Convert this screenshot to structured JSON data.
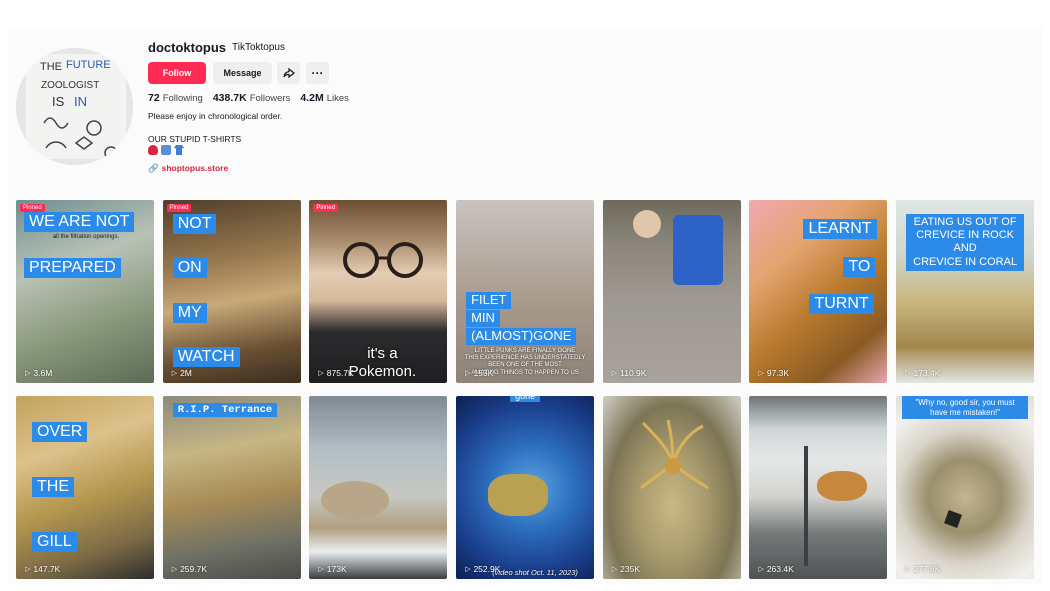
{
  "profile": {
    "username": "doctoktopus",
    "nickname": "TikToktopus",
    "follow_label": "Follow",
    "message_label": "Message",
    "share_icon": "share-icon",
    "more_icon": "more-icon",
    "more_glyph": "···",
    "stats": {
      "following_count": "72",
      "following_label": "Following",
      "followers_count": "438.7K",
      "followers_label": "Followers",
      "likes_count": "4.2M",
      "likes_label": "Likes"
    },
    "bio_line": "Please enjoy in chronological order.",
    "bio_shirts": "OUR STUPID T-SHIRTS",
    "bio_emojis": [
      "octopus",
      "down-arrow",
      "t-shirt"
    ],
    "link_text": "shoptopus.store",
    "avatar_text": [
      "THE FUTURE",
      "ZOOLOGIST",
      "IS IN"
    ]
  },
  "colors": {
    "brand": "#fe2c55",
    "caption_blue": "#2c8ae8",
    "link": "#d7263d"
  },
  "videos": [
    {
      "views": "3.6M",
      "pinned": "Pinned",
      "captions": [
        "WE ARE NOT",
        "PREPARED"
      ],
      "small": "all the filtration openings."
    },
    {
      "views": "2M",
      "pinned": "Pinned",
      "captions": [
        "NOT",
        "ON",
        "MY",
        "WATCH"
      ]
    },
    {
      "views": "875.7K",
      "pinned": "Pinned",
      "overlay": "it's a\nPokemon."
    },
    {
      "views": "153K",
      "captions": [
        "FILET",
        "MIN",
        "(ALMOST)GONE"
      ],
      "small": "LITTLE PUNKS ARE FINALLY GONE\nTHIS EXPERIENCE HAS UNDERSTATEDLY\nBEEN ONE OF THE MOST\nAMAZING THINGS TO HAPPEN TO US"
    },
    {
      "views": "110.9K"
    },
    {
      "views": "97.3K",
      "captions": [
        "LEARNT",
        "TO",
        "TURNT"
      ]
    },
    {
      "views": "173.4K",
      "captions_wide": "EATING US OUT OF\nCREVICE IN ROCK\nAND\nCREVICE IN CORAL"
    },
    {
      "views": "147.7K",
      "captions": [
        "OVER",
        "THE",
        "GILL"
      ]
    },
    {
      "views": "259.7K",
      "captions": [
        "R.I.P. Terrance"
      ]
    },
    {
      "views": "173K"
    },
    {
      "views": "252.9K",
      "captions": [
        "gone"
      ],
      "small": "(video shot Oct. 11, 2023)"
    },
    {
      "views": "235K"
    },
    {
      "views": "263.4K"
    },
    {
      "views": "277.8K",
      "captions_wide": "\"Why no, good sir, you must\nhave me mistaken!\""
    }
  ]
}
